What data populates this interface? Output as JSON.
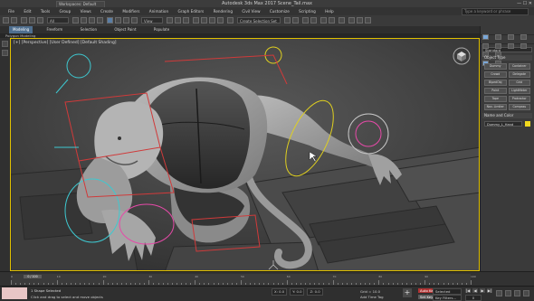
{
  "app": {
    "title": "Autodesk 3ds Max 2017     Scene_Tail.max",
    "workspace": "Workspaces: Default",
    "window_controls": "— ☐ ✕"
  },
  "menu": {
    "items": [
      "File",
      "Edit",
      "Tools",
      "Group",
      "Views",
      "Create",
      "Modifiers",
      "Animation",
      "Graph Editors",
      "Rendering",
      "Civil View",
      "Customize",
      "Scripting",
      "Help"
    ],
    "search_placeholder": "Type a keyword or phrase"
  },
  "toolbar": {
    "selection_filter": "All",
    "view_dropdown": "View",
    "selection_set": "Create Selection Set"
  },
  "ribbon": {
    "tabs": [
      "Modeling",
      "Freeform",
      "Selection",
      "Object Paint",
      "Populate"
    ],
    "active_tab": "Modeling",
    "subtitle": "Polygon Modeling"
  },
  "viewport": {
    "label": "[+] [Perspective] [User Defined] [Default Shading]"
  },
  "command_panel": {
    "category_dropdown": "Standard",
    "object_type_title": "Object Type",
    "object_buttons": [
      "Dummy",
      "Container",
      "Crowd",
      "Delegate",
      "BipedObj",
      "Grid",
      "Point",
      "LightMeter",
      "Tape",
      "Protractor",
      "Nav. Limiter",
      "Compass"
    ],
    "name_color_title": "Name and Color",
    "name_value": "Dummy_L_Hand",
    "swatch_color": "#f0d81e"
  },
  "timeline": {
    "slider_label": "0 / 100",
    "frame_marks": [
      "0",
      "10",
      "20",
      "30",
      "40",
      "50",
      "60",
      "70",
      "80",
      "90",
      "100"
    ]
  },
  "status": {
    "line1": "1 Shape Selected",
    "line2": "Click and drag to select and move objects",
    "coords": [
      "X: 0.0",
      "Y: 0.0",
      "Z: 0.0"
    ],
    "grid": "Grid = 10.0",
    "add_time_tag": "Add Time Tag",
    "auto_key": "Auto Key",
    "set_key": "Set Key",
    "selected_dropdown": "Selected",
    "key_filters": "Key Filters...",
    "current_frame": "0",
    "playback": [
      "|◀",
      "◀",
      "▶",
      "▶|",
      "▶▶"
    ]
  }
}
